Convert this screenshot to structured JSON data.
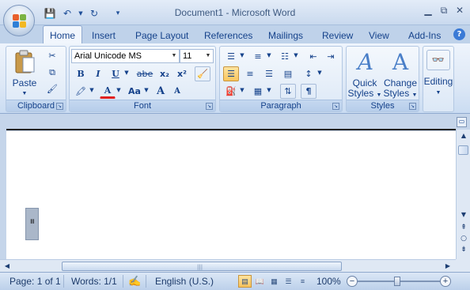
{
  "window": {
    "title": "Document1 - Microsoft Word",
    "controls": [
      "minimize",
      "restore",
      "close"
    ]
  },
  "quick_access": [
    "save-icon",
    "undo-icon",
    "redo-icon",
    "customize-icon"
  ],
  "tabs": [
    {
      "label": "Home",
      "active": true
    },
    {
      "label": "Insert"
    },
    {
      "label": "Page Layout"
    },
    {
      "label": "References"
    },
    {
      "label": "Mailings"
    },
    {
      "label": "Review"
    },
    {
      "label": "View"
    },
    {
      "label": "Add-Ins"
    }
  ],
  "ribbon": {
    "clipboard": {
      "label": "Clipboard",
      "paste": "Paste"
    },
    "font": {
      "label": "Font",
      "font_name": "Arial Unicode MS",
      "font_size": "11",
      "buttons": [
        "B",
        "I",
        "U",
        "abe",
        "x₂",
        "x²",
        "A",
        "Aa",
        "A",
        "A"
      ]
    },
    "paragraph": {
      "label": "Paragraph",
      "show_marks": "¶"
    },
    "styles": {
      "label": "Styles",
      "quick_styles": "Quick Styles",
      "change_styles": "Change Styles"
    },
    "editing": {
      "label": "Editing"
    }
  },
  "document": {
    "style_area_text": "≡"
  },
  "status": {
    "page": "Page: 1 of 1",
    "words": "Words: 1/1",
    "language": "English (U.S.)",
    "zoom": "100%",
    "zoom_level": 1.0,
    "active_view": "print-layout"
  },
  "colors": {
    "ribbon_bg": "#dde8f6",
    "text": "#15428b",
    "selected": "#f9c55d"
  }
}
